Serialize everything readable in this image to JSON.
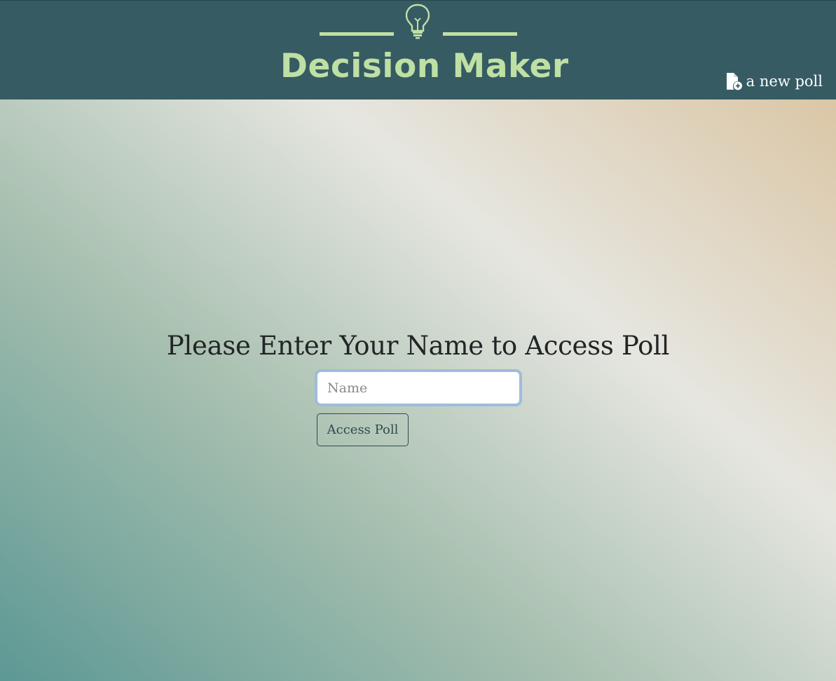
{
  "header": {
    "logo_text": "Decision Maker",
    "logo_icon": "lightbulb-icon",
    "new_poll_label": "a new poll",
    "new_poll_icon": "file-plus-icon"
  },
  "main": {
    "heading": "Please Enter Your Name to Access Poll",
    "name_placeholder": "Name",
    "name_value": "",
    "access_button_label": "Access Poll"
  },
  "colors": {
    "topbar": "#365b63",
    "logo": "#bfe0a4",
    "input_focus_ring": "#9ebcdc",
    "gradient": [
      "#5d9894",
      "#a8c0b0",
      "#e6e6e0",
      "#d8bf98"
    ]
  }
}
